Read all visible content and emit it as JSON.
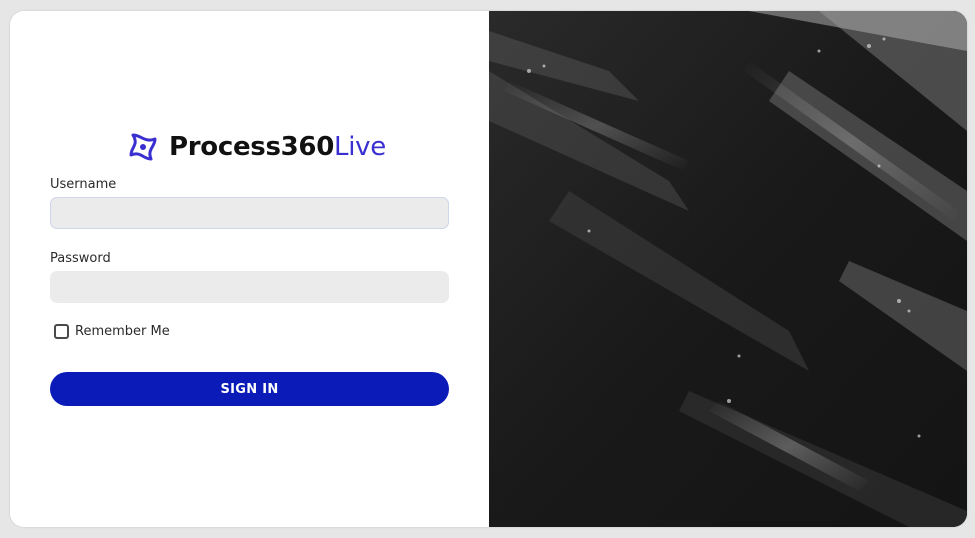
{
  "brand": {
    "name_bold": "Process360",
    "name_light": "Live",
    "accent_color": "#3a2fd0"
  },
  "form": {
    "username": {
      "label": "Username",
      "value": "",
      "placeholder": ""
    },
    "password": {
      "label": "Password",
      "value": "",
      "placeholder": ""
    },
    "remember_me": {
      "label": "Remember Me",
      "checked": false
    },
    "submit": {
      "label": "SIGN IN",
      "color": "#0a1bb8"
    }
  },
  "hero_image": {
    "description_icon": "abstract-dark-texture"
  }
}
